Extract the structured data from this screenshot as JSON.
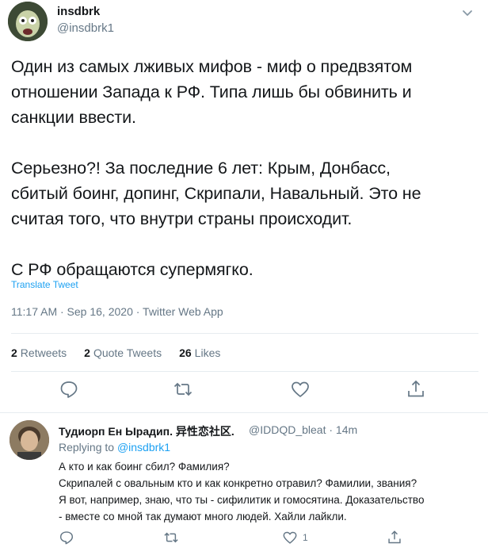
{
  "tweet": {
    "display_name": "insdbrk",
    "handle": "@insdbrk1",
    "text": "Один из самых лживых мифов - миф о предвзятом\nотношении Запада к РФ. Типа лишь бы обвинить и\nсанкции ввести.\n\nСерьезно?! За последние 6 лет: Крым, Донбасс,\nсбитый боинг, допинг, Скрипали, Навальный. Это не\nсчитая того, что внутри страны происходит.\n\nС РФ обращаются супермягко.",
    "translate_label": "Translate Tweet",
    "meta": "11:17 AM · Sep 16, 2020 · Twitter Web App",
    "retweets_count": "2",
    "retweets_label": "Retweets",
    "quotes_count": "2",
    "quotes_label": "Quote Tweets",
    "likes_count": "26",
    "likes_label": "Likes"
  },
  "reply": {
    "display_name": "Тудиорп Ен Ырадип. 异性恋社区.",
    "handle_time": "@IDDQD_bleat · 14m",
    "replying_prefix": "Replying to",
    "replying_to": "@insdbrk1",
    "text": "А кто и как боинг сбил? Фамилия?\nСкрипалей с овальным кто и как конкретно отравил? Фамилии, звания?\nЯ вот, например, знаю, что ты - сифилитик и гомосятина. Доказательство\n- вместе со мной так думают много людей. Хайли лайкли.",
    "like_count": "1"
  },
  "colors": {
    "accent": "#1da1f2",
    "secondary_text": "#657786",
    "divider": "#e6ecf0"
  },
  "icons": [
    "chevron-down-icon",
    "reply-icon",
    "retweet-icon",
    "like-icon",
    "share-icon"
  ]
}
